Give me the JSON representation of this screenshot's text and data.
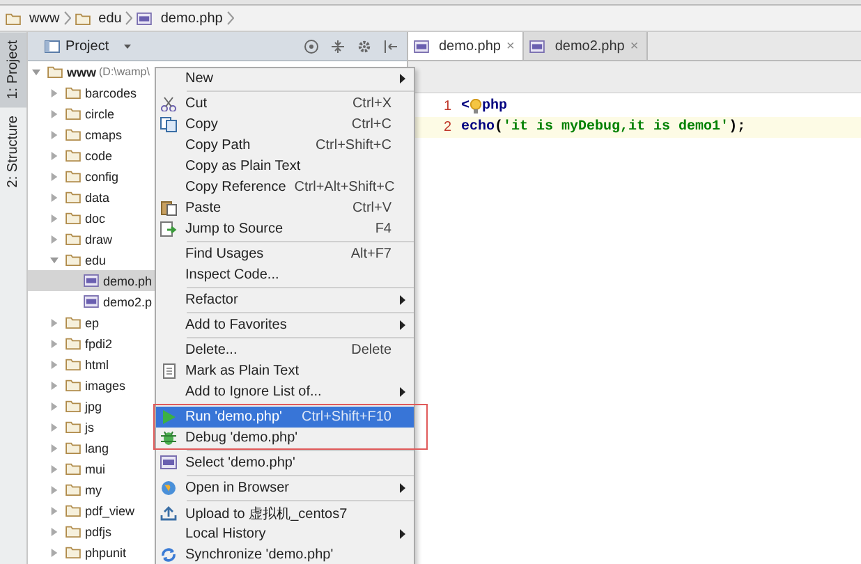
{
  "breadcrumbs": [
    {
      "kind": "folder",
      "label": "www"
    },
    {
      "kind": "folder",
      "label": "edu"
    },
    {
      "kind": "file",
      "label": "demo.php"
    }
  ],
  "tool_strip": [
    {
      "label": "1: Project",
      "selected": true
    },
    {
      "label": "2: Structure",
      "selected": false
    }
  ],
  "project_panel": {
    "title": "Project",
    "tree": [
      {
        "kind": "folder",
        "label": "www",
        "path": "(D:\\wamp\\",
        "expanded": true,
        "selected": false,
        "children": [
          {
            "kind": "folder",
            "label": "barcodes",
            "expanded": false,
            "selected": false
          },
          {
            "kind": "folder",
            "label": "circle",
            "expanded": false,
            "selected": false
          },
          {
            "kind": "folder",
            "label": "cmaps",
            "expanded": false,
            "selected": false
          },
          {
            "kind": "folder",
            "label": "code",
            "expanded": false,
            "selected": false
          },
          {
            "kind": "folder",
            "label": "config",
            "expanded": false,
            "selected": false
          },
          {
            "kind": "folder",
            "label": "data",
            "expanded": false,
            "selected": false
          },
          {
            "kind": "folder",
            "label": "doc",
            "expanded": false,
            "selected": false
          },
          {
            "kind": "folder",
            "label": "draw",
            "expanded": false,
            "selected": false
          },
          {
            "kind": "folder",
            "label": "edu",
            "expanded": true,
            "selected": false,
            "children": [
              {
                "kind": "file",
                "label": "demo.ph",
                "selected": true
              },
              {
                "kind": "file",
                "label": "demo2.p",
                "selected": false
              }
            ]
          },
          {
            "kind": "folder",
            "label": "ep",
            "expanded": false,
            "selected": false
          },
          {
            "kind": "folder",
            "label": "fpdi2",
            "expanded": false,
            "selected": false
          },
          {
            "kind": "folder",
            "label": "html",
            "expanded": false,
            "selected": false
          },
          {
            "kind": "folder",
            "label": "images",
            "expanded": false,
            "selected": false
          },
          {
            "kind": "folder",
            "label": "jpg",
            "expanded": false,
            "selected": false
          },
          {
            "kind": "folder",
            "label": "js",
            "expanded": false,
            "selected": false
          },
          {
            "kind": "folder",
            "label": "lang",
            "expanded": false,
            "selected": false
          },
          {
            "kind": "folder",
            "label": "mui",
            "expanded": false,
            "selected": false
          },
          {
            "kind": "folder",
            "label": "my",
            "expanded": false,
            "selected": false
          },
          {
            "kind": "folder",
            "label": "pdf_view",
            "expanded": false,
            "selected": false
          },
          {
            "kind": "folder",
            "label": "pdfjs",
            "expanded": false,
            "selected": false
          },
          {
            "kind": "folder",
            "label": "phpunit",
            "expanded": false,
            "selected": false
          }
        ]
      }
    ]
  },
  "editor": {
    "tabs": [
      {
        "label": "demo.php",
        "close": "×",
        "selected": true
      },
      {
        "label": "demo2.php",
        "close": "×",
        "selected": false
      }
    ],
    "lines": [
      {
        "number": "1",
        "current": false,
        "tokens": [
          {
            "kind": "tag",
            "text": "<"
          },
          {
            "kind": "bulb"
          },
          {
            "kind": "tag",
            "text": "php"
          }
        ]
      },
      {
        "number": "2",
        "current": true,
        "tokens": [
          {
            "kind": "keyword",
            "text": "echo"
          },
          {
            "kind": "plain",
            "text": "("
          },
          {
            "kind": "string",
            "text": "'it is myDebug,it is demo1'"
          },
          {
            "kind": "plain",
            "text": ");"
          }
        ]
      }
    ]
  },
  "context_menu": [
    {
      "kind": "item",
      "label": "New",
      "submenu": true,
      "selected": false,
      "marked": false
    },
    {
      "kind": "separator"
    },
    {
      "kind": "item",
      "label": "Cut",
      "shortcut": "Ctrl+X",
      "submenu": false,
      "selected": false,
      "marked": false
    },
    {
      "kind": "item",
      "label": "Copy",
      "shortcut": "Ctrl+C",
      "submenu": false,
      "selected": false,
      "marked": false
    },
    {
      "kind": "item",
      "label": "Copy Path",
      "shortcut": "Ctrl+Shift+C",
      "submenu": false,
      "selected": false,
      "marked": false
    },
    {
      "kind": "item",
      "label": "Copy as Plain Text",
      "submenu": false,
      "selected": false,
      "marked": false
    },
    {
      "kind": "item",
      "label": "Copy Reference",
      "shortcut": "Ctrl+Alt+Shift+C",
      "submenu": false,
      "selected": false,
      "marked": false
    },
    {
      "kind": "item",
      "label": "Paste",
      "shortcut": "Ctrl+V",
      "submenu": false,
      "selected": false,
      "marked": false
    },
    {
      "kind": "item",
      "label": "Jump to Source",
      "shortcut": "F4",
      "submenu": false,
      "selected": false,
      "marked": false
    },
    {
      "kind": "separator"
    },
    {
      "kind": "item",
      "label": "Find Usages",
      "shortcut": "Alt+F7",
      "submenu": false,
      "selected": false,
      "marked": false
    },
    {
      "kind": "item",
      "label": "Inspect Code...",
      "submenu": false,
      "selected": false,
      "marked": false
    },
    {
      "kind": "separator"
    },
    {
      "kind": "item",
      "label": "Refactor",
      "submenu": true,
      "selected": false,
      "marked": false
    },
    {
      "kind": "separator"
    },
    {
      "kind": "item",
      "label": "Add to Favorites",
      "submenu": true,
      "selected": false,
      "marked": false
    },
    {
      "kind": "separator"
    },
    {
      "kind": "item",
      "label": "Delete...",
      "shortcut": "Delete",
      "submenu": false,
      "selected": false,
      "marked": false
    },
    {
      "kind": "item",
      "label": "Mark as Plain Text",
      "submenu": false,
      "selected": false,
      "marked": false
    },
    {
      "kind": "item",
      "label": "Add to Ignore List of...",
      "submenu": true,
      "selected": false,
      "marked": false
    },
    {
      "kind": "separator"
    },
    {
      "kind": "item",
      "label": "Run 'demo.php'",
      "shortcut": "Ctrl+Shift+F10",
      "submenu": false,
      "selected": true,
      "marked": true
    },
    {
      "kind": "item",
      "label": "Debug 'demo.php'",
      "submenu": false,
      "selected": false,
      "marked": true
    },
    {
      "kind": "separator"
    },
    {
      "kind": "item",
      "label": "Select 'demo.php'",
      "submenu": false,
      "selected": false,
      "marked": false
    },
    {
      "kind": "separator"
    },
    {
      "kind": "item",
      "label": "Open in Browser",
      "submenu": true,
      "selected": false,
      "marked": false
    },
    {
      "kind": "separator"
    },
    {
      "kind": "item",
      "label": "Upload to 虚拟机_centos7",
      "submenu": false,
      "selected": false,
      "marked": false
    },
    {
      "kind": "item",
      "label": "Local History",
      "submenu": true,
      "selected": false,
      "marked": false
    },
    {
      "kind": "item",
      "label": "Synchronize 'demo.php'",
      "submenu": false,
      "selected": false,
      "marked": false
    }
  ]
}
